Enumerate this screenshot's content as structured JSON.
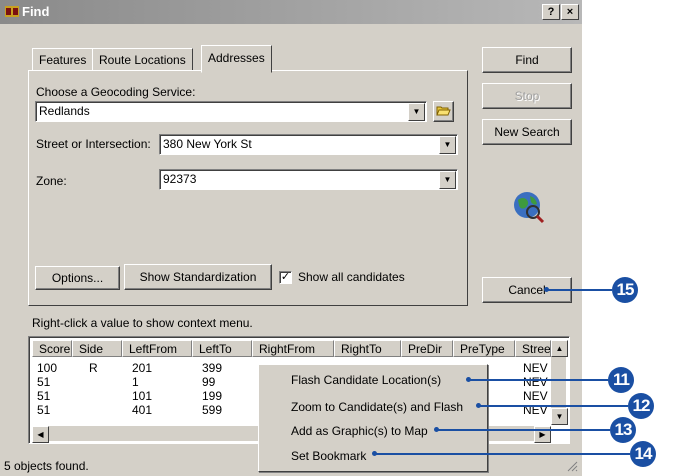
{
  "window": {
    "title": "Find",
    "help_btn": "?",
    "close_btn": "×"
  },
  "tabs": [
    {
      "label": "Features"
    },
    {
      "label": "Route Locations"
    },
    {
      "label": "Addresses"
    }
  ],
  "form": {
    "geocoding_label": "Choose a Geocoding Service:",
    "geocoding_value": "Redlands",
    "street_label": "Street or Intersection:",
    "street_value": "380 New York St",
    "zone_label": "Zone:",
    "zone_value": "92373",
    "options_button": "Options...",
    "standardization_button": "Show Standardization",
    "show_all_label": "Show all candidates",
    "show_all_checked": true
  },
  "side_buttons": {
    "find": "Find",
    "stop": "Stop",
    "new_search": "New Search",
    "cancel": "Cancel"
  },
  "results": {
    "hint": "Right-click a value to show context menu.",
    "columns": [
      "Score",
      "Side",
      "LeftFrom",
      "LeftTo",
      "RightFrom",
      "RightTo",
      "PreDir",
      "PreType",
      "Stree"
    ],
    "rows": [
      [
        "100",
        "R",
        "201",
        "399",
        "NEV"
      ],
      [
        "51",
        "",
        "1",
        "99",
        "NEV"
      ],
      [
        "51",
        "",
        "101",
        "199",
        "NEV"
      ],
      [
        "51",
        "",
        "401",
        "599",
        "NEV"
      ]
    ],
    "status": "5 objects found."
  },
  "context_menu": [
    "Flash Candidate Location(s)",
    "Zoom to Candidate(s) and Flash",
    "Add as Graphic(s) to Map",
    "Set Bookmark"
  ],
  "callouts": [
    "15",
    "11",
    "12",
    "13",
    "14"
  ],
  "icons": {
    "app": "binoculars-icon",
    "folder": "open-folder-icon",
    "globe": "globe-search-icon"
  },
  "colors": {
    "window": "#d4d0c8",
    "callout": "#1a4fa3"
  }
}
